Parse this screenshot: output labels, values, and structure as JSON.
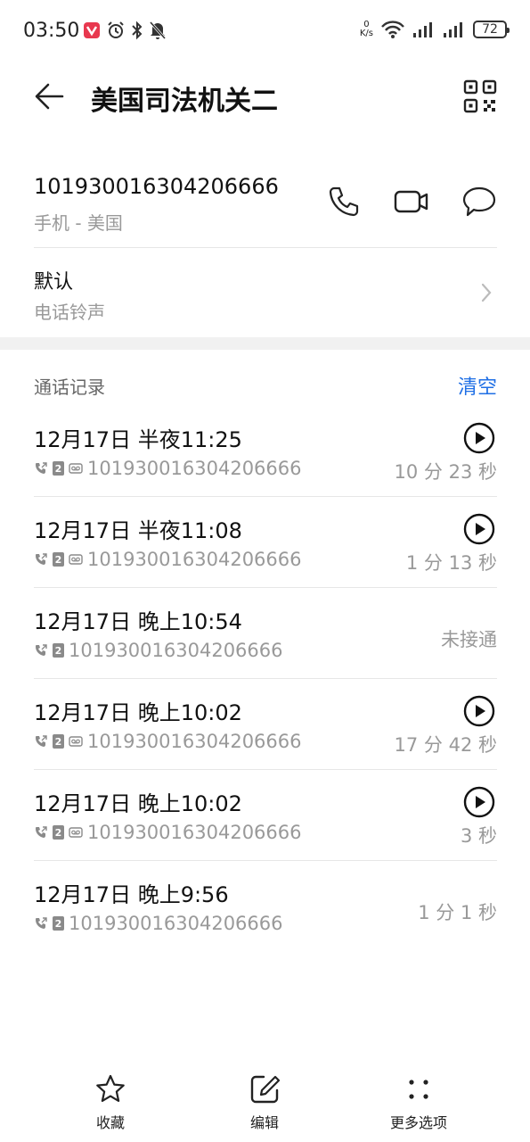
{
  "status_bar": {
    "time": "03:50",
    "net_speed_value": "0",
    "net_speed_unit": "K/s",
    "battery": "72"
  },
  "header": {
    "title": "美国司法机关二"
  },
  "contact": {
    "number": "101930016304206666",
    "number_label": "手机 - 美国"
  },
  "ringtone": {
    "title": "默认",
    "subtitle": "电话铃声"
  },
  "call_log": {
    "title": "通话记录",
    "clear_label": "清空",
    "items": [
      {
        "date": "12月17日 半夜11:25",
        "number": "101930016304206666",
        "duration": "10 分 23 秒",
        "has_recording": true
      },
      {
        "date": "12月17日 半夜11:08",
        "number": "101930016304206666",
        "duration": "1 分 13 秒",
        "has_recording": true
      },
      {
        "date": "12月17日 晚上10:54",
        "number": "101930016304206666",
        "status": "未接通",
        "has_recording": false
      },
      {
        "date": "12月17日 晚上10:02",
        "number": "101930016304206666",
        "duration": "17 分 42 秒",
        "has_recording": true
      },
      {
        "date": "12月17日 晚上10:02",
        "number": "101930016304206666",
        "duration": "3 秒",
        "has_recording": true
      },
      {
        "date": "12月17日 晚上9:56",
        "number": "101930016304206666",
        "status": "1 分 1 秒",
        "has_recording": false
      }
    ]
  },
  "bottom_bar": {
    "favorite_label": "收藏",
    "edit_label": "编辑",
    "more_label": "更多选项"
  },
  "colors": {
    "accent": "#1f6fe5",
    "secondary_text": "#999999"
  }
}
